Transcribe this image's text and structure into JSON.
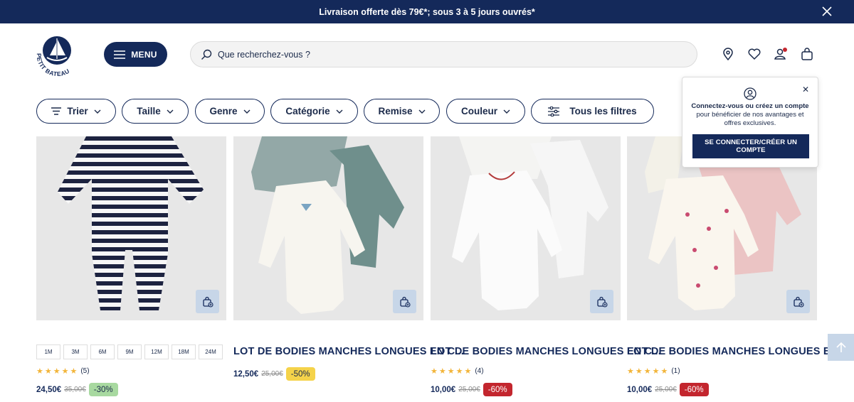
{
  "promo_bar": {
    "text": "Livraison offerte dès 79€*; sous 3 à 5 jours ouvrés*"
  },
  "header": {
    "logo_text": "PETIT BATEAU",
    "menu_label": "MENU",
    "search_placeholder": "Que recherchez-vous ?"
  },
  "filters": [
    "Trier",
    "Taille",
    "Genre",
    "Catégorie",
    "Remise",
    "Couleur",
    "Tous les filtres"
  ],
  "login_popup": {
    "bold1": "Connectez-vous ou créez un compte",
    "rest": " pour bénéficier de nos avantages et offres exclusives.",
    "cta": "SE CONNECTER/CRÉER UN COMPTE"
  },
  "products": [
    {
      "sizes": [
        "1M",
        "3M",
        "6M",
        "9M",
        "12M",
        "18M",
        "24M"
      ],
      "reviews": "(5)",
      "price": "24,50€",
      "old_price": "35,00€",
      "discount": "-30%"
    },
    {
      "title": "LOT DE BODIES MANCHES LONGUES EN C...",
      "price": "12,50€",
      "old_price": "25,00€",
      "discount": "-50%"
    },
    {
      "title": "LOT DE BODIES MANCHES LONGUES EN C...",
      "reviews": "(4)",
      "price": "10,00€",
      "old_price": "25,00€",
      "discount": "-60%"
    },
    {
      "title": "LOT DE BODIES MANCHES LONGUES EN C...",
      "reviews": "(1)",
      "price": "10,00€",
      "old_price": "25,00€",
      "discount": "-60%"
    }
  ],
  "colors": {
    "navy": "#14295a",
    "green_badge": "#a8d9a0",
    "yellow_badge": "#f5d34a",
    "red_badge": "#c3262e",
    "star": "#f2b53a"
  }
}
